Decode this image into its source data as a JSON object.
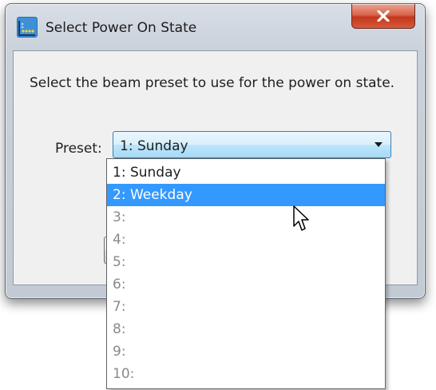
{
  "window": {
    "title": "Select Power On State",
    "message": "Select the beam preset to use for the power on state.",
    "close_glyph": "x"
  },
  "preset": {
    "label": "Preset:",
    "value": "1: Sunday"
  },
  "dropdown": {
    "options": [
      {
        "label": "1: Sunday",
        "state": "normal"
      },
      {
        "label": "2: Weekday",
        "state": "highlighted"
      },
      {
        "label": "3:",
        "state": "empty"
      },
      {
        "label": "4:",
        "state": "empty"
      },
      {
        "label": "5:",
        "state": "empty"
      },
      {
        "label": "6:",
        "state": "empty"
      },
      {
        "label": "7:",
        "state": "empty"
      },
      {
        "label": "8:",
        "state": "empty"
      },
      {
        "label": "9:",
        "state": "empty"
      },
      {
        "label": "10:",
        "state": "empty"
      }
    ]
  },
  "icons": {
    "app": "app-grid-icon",
    "close": "close-icon",
    "dropdown": "chevron-down-icon",
    "cursor": "mouse-pointer-icon"
  },
  "colors": {
    "highlight": "#3399ff",
    "close_button": "#c2381d",
    "combo_border": "#3c7fb1"
  }
}
